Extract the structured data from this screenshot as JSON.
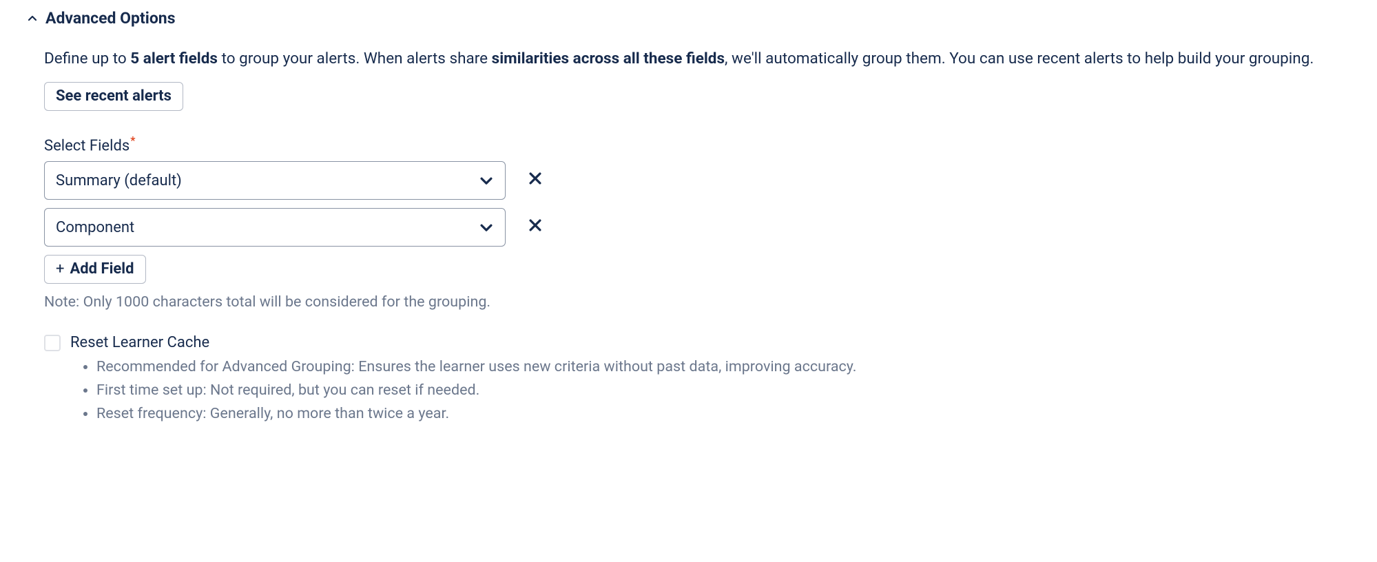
{
  "section": {
    "title": "Advanced Options"
  },
  "description": {
    "part1": "Define up to ",
    "bold1": "5 alert fields",
    "part2": " to group your alerts. When alerts share ",
    "bold2": "similarities across all these fields",
    "part3": ", we'll automatically group them. You can use recent alerts to help build your grouping."
  },
  "buttons": {
    "see_recent": "See recent alerts",
    "add_field": "Add Field"
  },
  "fields": {
    "label": "Select Fields",
    "items": [
      {
        "value": "Summary (default)"
      },
      {
        "value": "Component"
      }
    ],
    "note": "Note: Only 1000 characters total will be considered for the grouping."
  },
  "reset": {
    "label": "Reset Learner Cache",
    "bullets": [
      "Recommended for Advanced Grouping: Ensures the learner uses new criteria without past data, improving accuracy.",
      "First time set up: Not required, but you can reset if needed.",
      "Reset frequency: Generally, no more than twice a year."
    ]
  }
}
